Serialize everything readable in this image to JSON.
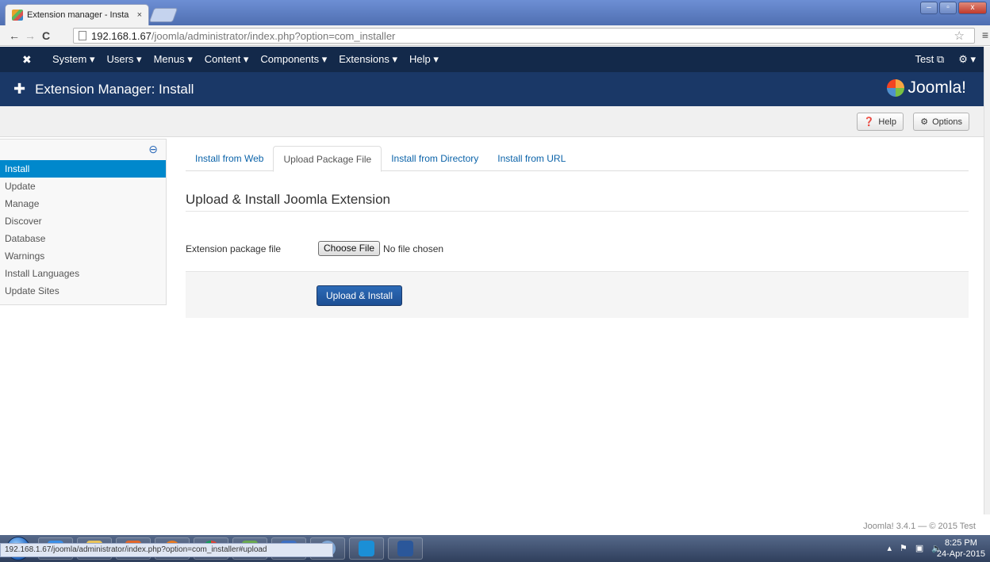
{
  "browser": {
    "tab_title": "Extension manager - Insta",
    "tab_close": "×",
    "url_host": "192.168.1.67",
    "url_path": "/joomla/administrator/index.php?option=com_installer",
    "window_minimize": "–",
    "window_maximize": "▫",
    "window_close": "x"
  },
  "jnav": {
    "items": [
      "System ▾",
      "Users ▾",
      "Menus ▾",
      "Content ▾",
      "Components ▾",
      "Extensions ▾",
      "Help ▾"
    ],
    "user": "Test ⧉",
    "settings": "⚙ ▾"
  },
  "titlebar": {
    "title": "Extension Manager: Install",
    "brand": "Joomla!"
  },
  "toolbar": {
    "help_label": "Help",
    "options_label": "Options"
  },
  "sidebar": {
    "items": [
      "Install",
      "Update",
      "Manage",
      "Discover",
      "Database",
      "Warnings",
      "Install Languages",
      "Update Sites"
    ],
    "active_index": 0
  },
  "tabs": {
    "items": [
      "Install from Web",
      "Upload Package File",
      "Install from Directory",
      "Install from URL"
    ],
    "active_index": 1
  },
  "form": {
    "section_title": "Upload & Install Joomla Extension",
    "field_label": "Extension package file",
    "choose_button": "Choose File",
    "file_status": "No file chosen",
    "submit_label": "Upload & Install"
  },
  "status_url": "192.168.1.67/joomla/administrator/index.php?option=com_installer#upload",
  "footer": "Joomla! 3.4.1 — © 2015 Test",
  "taskbar": {
    "time": "8:25 PM",
    "date": "24-Apr-2015",
    "apps": [
      "ie-icon",
      "explorer-icon",
      "media-icon",
      "firefox-icon",
      "chrome-icon",
      "utility-icon",
      "network-icon",
      "thunderbird-icon",
      "teamviewer-icon",
      "word-icon"
    ]
  },
  "colors": {
    "nav_bg": "#13294a",
    "title_bg": "#1a3867",
    "active_blue": "#0088cc",
    "link_blue": "#0b63a9"
  }
}
